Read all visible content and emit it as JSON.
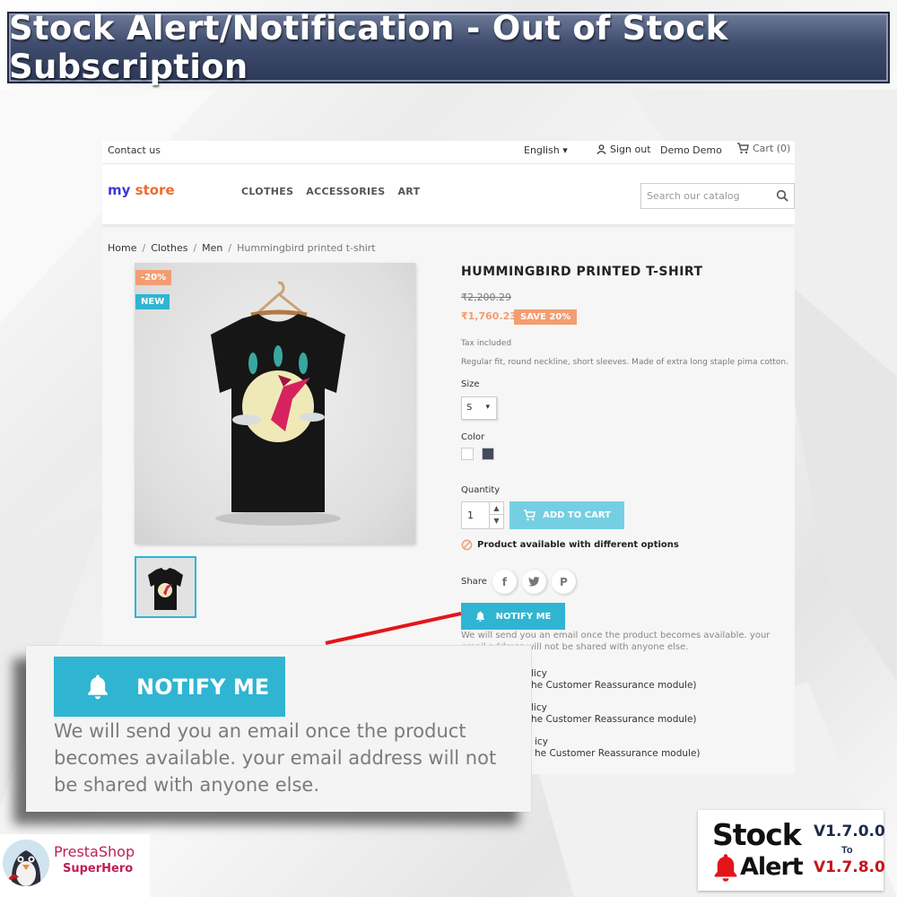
{
  "banner": {
    "title": "Stock Alert/Notification - Out of Stock Subscription"
  },
  "store": {
    "topbar": {
      "contact": "Contact us",
      "language": "English",
      "sign_out": "Sign out",
      "user_name": "Demo Demo",
      "cart": "Cart (0)"
    },
    "logo": {
      "part1": "my",
      "part2": "store"
    },
    "nav": [
      "CLOTHES",
      "ACCESSORIES",
      "ART"
    ],
    "search": {
      "placeholder": "Search our catalog"
    },
    "breadcrumb": [
      "Home",
      "Clothes",
      "Men",
      "Hummingbird printed t-shirt"
    ],
    "badges": {
      "discount": "-20%",
      "new": "NEW"
    },
    "product": {
      "title": "HUMMINGBIRD PRINTED T-SHIRT",
      "old_price": "₹2,200.29",
      "price": "₹1,760.23",
      "save": "SAVE 20%",
      "tax": "Tax included",
      "description": "Regular fit, round neckline, short sleeves. Made of extra long staple pima cotton.",
      "size_label": "Size",
      "size_value": "S",
      "color_label": "Color",
      "colors": [
        "#ffffff",
        "#434a5c"
      ],
      "quantity_label": "Quantity",
      "quantity": "1",
      "add_to_cart": "ADD TO CART",
      "availability": "Product available with different options",
      "share_label": "Share",
      "notify_button": "NOTIFY ME",
      "notify_note": "We will send you an email once the product becomes available. your email address will not be shared with anyone else.",
      "policies": [
        {
          "title": "licy",
          "sub": "he Customer Reassurance module)"
        },
        {
          "title": "licy",
          "sub": "he Customer Reassurance module)"
        },
        {
          "title": "icy",
          "sub": "he Customer Reassurance module)"
        }
      ]
    }
  },
  "zoom": {
    "notify_button": "NOTIFY ME",
    "note": "We will send you an email once the product becomes available. your email address will not be shared with anyone else."
  },
  "logos": {
    "prestashop": {
      "name": "PrestaShop",
      "sub": "SuperHero"
    },
    "stock_alert": {
      "word1": "Stock",
      "word2": "Alert",
      "from": "V1.7.0.0",
      "to": "To",
      "until": "V1.7.8.0"
    }
  },
  "colors": {
    "accent": "#2fb5d2",
    "sale": "#f39d72",
    "banner": "#3f4c6d",
    "red": "#e3151b"
  }
}
